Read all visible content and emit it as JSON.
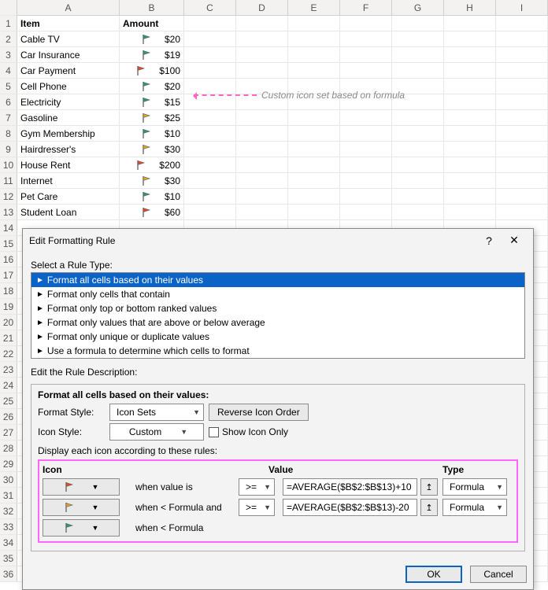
{
  "columns": [
    "A",
    "B",
    "C",
    "D",
    "E",
    "F",
    "G",
    "H",
    "I"
  ],
  "header": {
    "item": "Item",
    "amount": "Amount"
  },
  "rows": [
    {
      "n": "1"
    },
    {
      "n": "2",
      "item": "Cable TV",
      "flag": "green",
      "amount": "$20"
    },
    {
      "n": "3",
      "item": "Car Insurance",
      "flag": "green",
      "amount": "$19"
    },
    {
      "n": "4",
      "item": "Car Payment",
      "flag": "red",
      "amount": "$100"
    },
    {
      "n": "5",
      "item": "Cell Phone",
      "flag": "green",
      "amount": "$20"
    },
    {
      "n": "6",
      "item": "Electricity",
      "flag": "green",
      "amount": "$15"
    },
    {
      "n": "7",
      "item": "Gasoline",
      "flag": "yellow",
      "amount": "$25"
    },
    {
      "n": "8",
      "item": "Gym Membership",
      "flag": "green",
      "amount": "$10"
    },
    {
      "n": "9",
      "item": "Hairdresser's",
      "flag": "yellow",
      "amount": "$30"
    },
    {
      "n": "10",
      "item": "House Rent",
      "flag": "red",
      "amount": "$200"
    },
    {
      "n": "11",
      "item": "Internet",
      "flag": "yellow",
      "amount": "$30"
    },
    {
      "n": "12",
      "item": "Pet Care",
      "flag": "green",
      "amount": "$10"
    },
    {
      "n": "13",
      "item": "Student Loan",
      "flag": "red",
      "amount": "$60"
    }
  ],
  "extra_rows": [
    "14",
    "15",
    "16",
    "17",
    "18",
    "19",
    "20",
    "21",
    "22",
    "23",
    "24",
    "25",
    "26",
    "27",
    "28",
    "29",
    "30",
    "31",
    "32",
    "33",
    "34",
    "35",
    "36"
  ],
  "annotation": "Custom icon set based on formula",
  "dialog": {
    "title": "Edit Formatting Rule",
    "help": "?",
    "close": "✕",
    "select_label": "Select a Rule Type:",
    "rule_types": [
      "Format all cells based on their values",
      "Format only cells that contain",
      "Format only top or bottom ranked values",
      "Format only values that are above or below average",
      "Format only unique or duplicate values",
      "Use a formula to determine which cells to format"
    ],
    "edit_label": "Edit the Rule Description:",
    "desc_title": "Format all cells based on their values:",
    "format_style_label": "Format Style:",
    "format_style_value": "Icon Sets",
    "reverse_btn": "Reverse Icon Order",
    "icon_style_label": "Icon Style:",
    "icon_style_value": "Custom",
    "show_icon_only": "Show Icon Only",
    "display_rules_label": "Display each icon according to these rules:",
    "table_head": {
      "icon": "Icon",
      "value": "Value",
      "type": "Type"
    },
    "rules": [
      {
        "flag": "red",
        "cond": "when value is",
        "op": ">=",
        "value": "=AVERAGE($B$2:$B$13)+10",
        "type": "Formula"
      },
      {
        "flag": "yellow",
        "cond": "when < Formula and",
        "op": ">=",
        "value": "=AVERAGE($B$2:$B$13)-20",
        "type": "Formula"
      },
      {
        "flag": "green",
        "cond": "when < Formula"
      }
    ],
    "ok": "OK",
    "cancel": "Cancel"
  },
  "flag_colors": {
    "red": "#e04a2b",
    "yellow": "#e0a22b",
    "green": "#2b9a7a"
  }
}
